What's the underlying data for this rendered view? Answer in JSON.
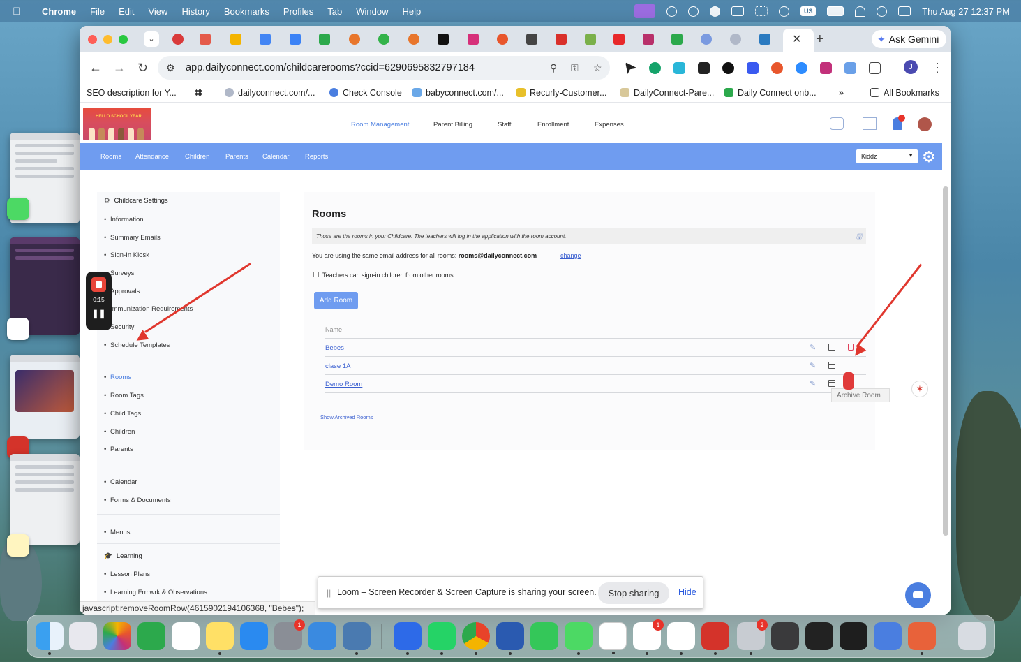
{
  "menubar": {
    "app": "Chrome",
    "items": [
      "File",
      "Edit",
      "View",
      "History",
      "Bookmarks",
      "Profiles",
      "Tab",
      "Window",
      "Help"
    ],
    "keyboard": "US",
    "datetime": "Thu Aug 27  12:37 PM"
  },
  "browser": {
    "ask_gemini": "Ask Gemini",
    "url": "app.dailyconnect.com/childcarerooms?ccid=6290695832797184",
    "profile_initial": "J",
    "bookmarks": [
      "SEO description for Y...",
      "dailyconnect.com/...",
      "Check Console",
      "babyconnect.com/...",
      "Recurly-Customer...",
      "DailyConnect-Pare...",
      "Daily Connect onb...",
      "All Bookmarks"
    ],
    "status_url": "javascript:removeRoomRow(4615902194106368, \"Bebes\");"
  },
  "app": {
    "top_nav": [
      "Room Management",
      "Parent Billing",
      "Staff",
      "Enrollment",
      "Expenses"
    ],
    "sub_nav": [
      "Rooms",
      "Attendance",
      "Children",
      "Parents",
      "Calendar",
      "Reports"
    ],
    "center_select": "Kiddz",
    "logo_text": "HELLO SCHOOL YEAR"
  },
  "sidebar": {
    "settings_header": "Childcare Settings",
    "group1": [
      "Information",
      "Summary Emails",
      "Sign-In Kiosk",
      "Surveys",
      "Approvals",
      "Immunization Requirements",
      "Security",
      "Schedule Templates"
    ],
    "group2": [
      "Rooms",
      "Room Tags",
      "Child Tags",
      "Children",
      "Parents"
    ],
    "group3": [
      "Calendar",
      "Forms & Documents"
    ],
    "group4": [
      "Menus"
    ],
    "learning_header": "Learning",
    "group5": [
      "Lesson Plans",
      "Learning Frmwrk & Observations"
    ]
  },
  "rooms": {
    "title": "Rooms",
    "note": "Those are the rooms in your Childcare. The teachers will log in the application with the room account.",
    "email_prefix": "You are using the same email address for all rooms:",
    "email": "rooms@dailyconnect.com",
    "change": "change",
    "checkbox_label": "Teachers can sign-in children from other rooms",
    "add_button": "Add Room",
    "name_header": "Name",
    "rows": [
      "Bebes",
      "clase 1A",
      "Demo Room"
    ],
    "show_archived": "Show Archived Rooms",
    "tooltip": "Archive Room"
  },
  "recorder": {
    "time": "0:15"
  },
  "loom": {
    "message": "Loom – Screen Recorder & Screen Capture is sharing your screen.",
    "stop": "Stop sharing",
    "hide": "Hide"
  },
  "dock": {
    "badges": {
      "settings": "1",
      "slack": "1",
      "printer": "2"
    }
  },
  "colors": {
    "accent": "#6f9cf0",
    "link": "#3a5fd0",
    "arrow": "#e0372e",
    "danger": "#e0405a"
  }
}
